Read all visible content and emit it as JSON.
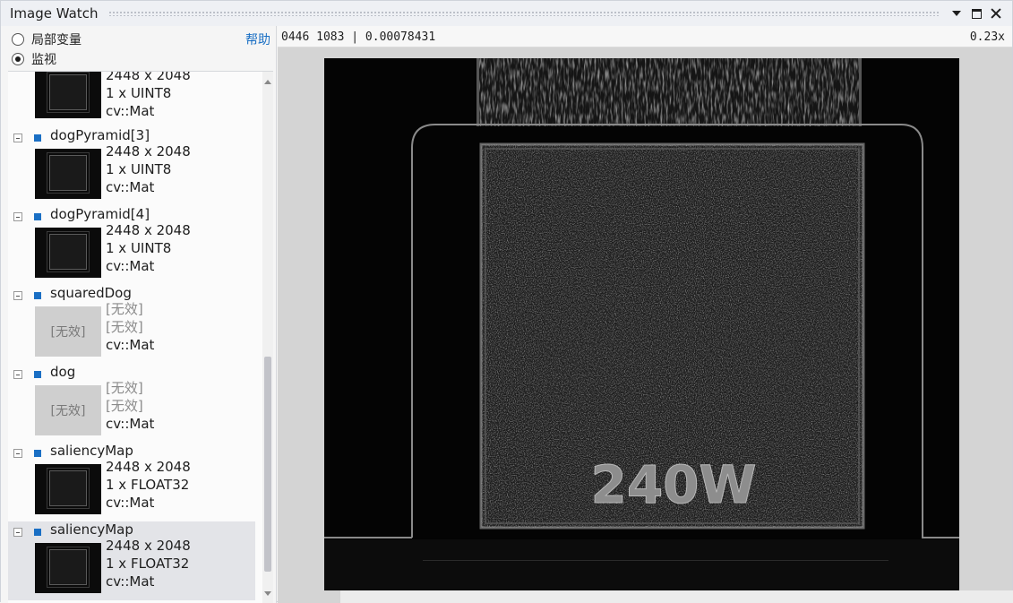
{
  "window": {
    "title": "Image Watch"
  },
  "scope": {
    "options": [
      {
        "label": "局部变量",
        "selected": false
      },
      {
        "label": "监视",
        "selected": true
      }
    ],
    "help_label": "帮助"
  },
  "watch_list": [
    {
      "name": "",
      "dims": "2448 x 2048",
      "type": "1 x UINT8",
      "class": "cv::Mat",
      "valid": true
    },
    {
      "name": "dogPyramid[3]",
      "dims": "2448 x 2048",
      "type": "1 x UINT8",
      "class": "cv::Mat",
      "valid": true
    },
    {
      "name": "dogPyramid[4]",
      "dims": "2448 x 2048",
      "type": "1 x UINT8",
      "class": "cv::Mat",
      "valid": true
    },
    {
      "name": "squaredDog",
      "dims": "[无效]",
      "type": "[无效]",
      "class": "cv::Mat",
      "valid": false,
      "placeholder": "[无效]"
    },
    {
      "name": "dog",
      "dims": "[无效]",
      "type": "[无效]",
      "class": "cv::Mat",
      "valid": false,
      "placeholder": "[无效]"
    },
    {
      "name": "saliencyMap",
      "dims": "2448 x 2048",
      "type": "1 x FLOAT32",
      "class": "cv::Mat",
      "valid": true
    },
    {
      "name": "saliencyMap",
      "dims": "2448 x 2048",
      "type": "1 x FLOAT32",
      "class": "cv::Mat",
      "valid": true,
      "selected": true
    }
  ],
  "viewer": {
    "pixel_info": "0446 1083 | 0.00078431",
    "zoom": "0.23x",
    "image_text": "240W"
  }
}
